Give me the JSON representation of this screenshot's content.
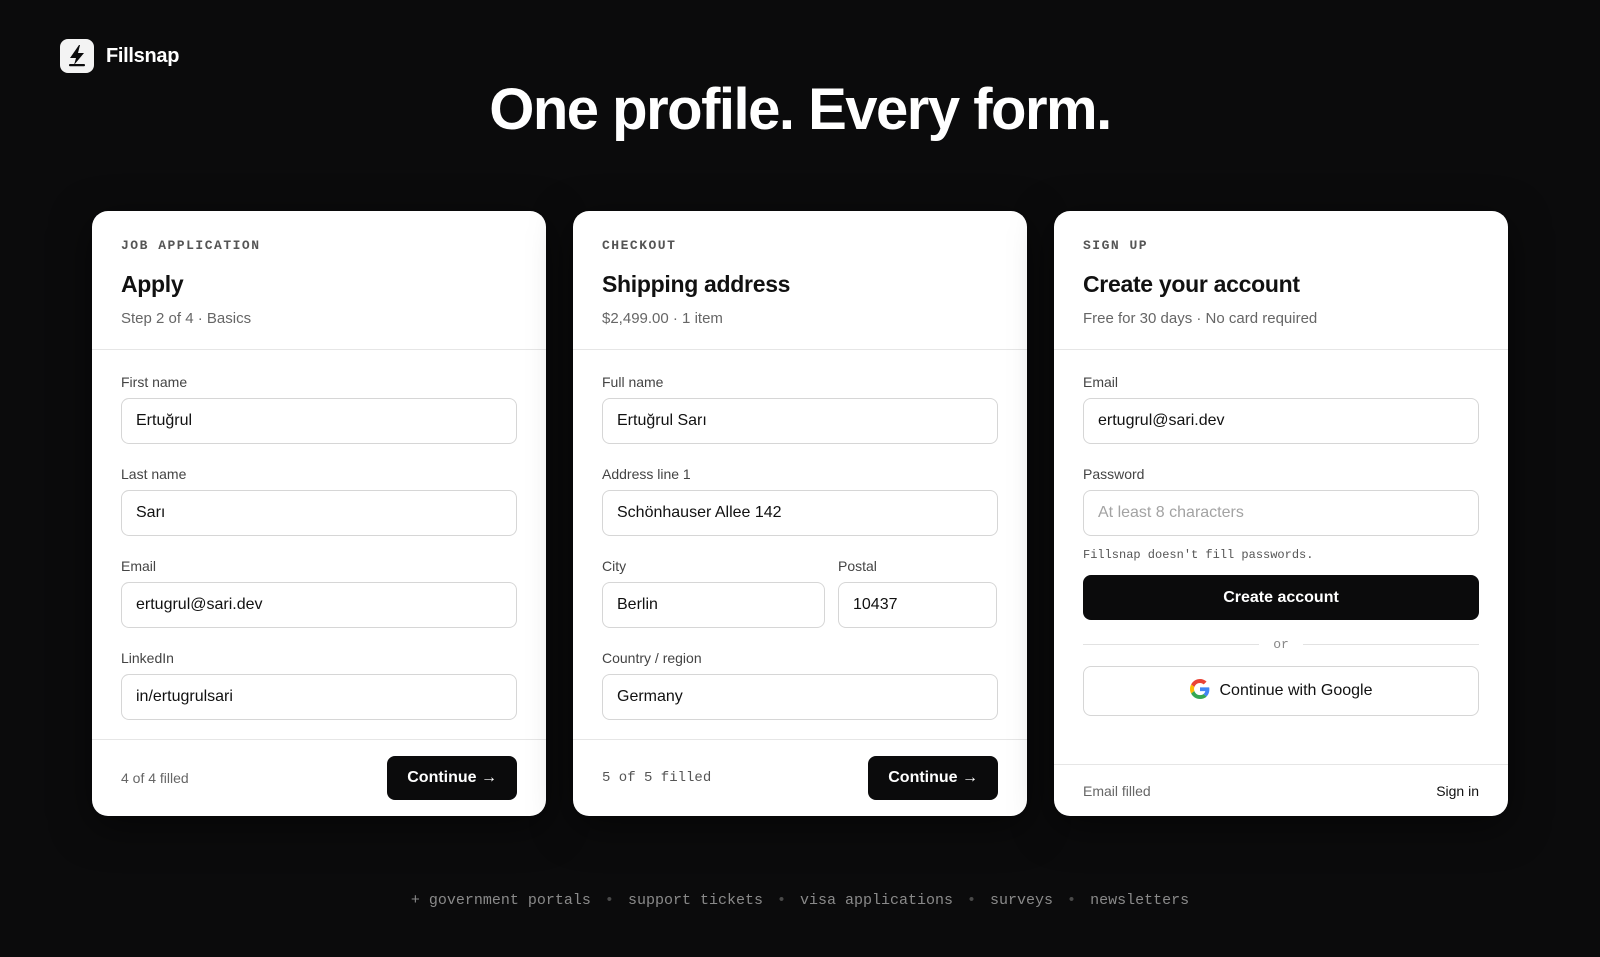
{
  "brand": {
    "name": "Fillsnap",
    "icon": "lightning-bolt-icon"
  },
  "headline": "One profile. Every form.",
  "cards": {
    "job": {
      "eyebrow": "JOB APPLICATION",
      "title": "Apply",
      "subtitle": "Step 2 of 4 · Basics",
      "fields": {
        "first_name": {
          "label": "First name",
          "value": "Ertuğrul"
        },
        "last_name": {
          "label": "Last name",
          "value": "Sarı"
        },
        "email": {
          "label": "Email",
          "value": "ertugrul@sari.dev"
        },
        "linkedin": {
          "label": "LinkedIn",
          "value": "in/ertugrulsari"
        }
      },
      "footer_status": "4 of 4 filled",
      "continue_label": "Continue →"
    },
    "checkout": {
      "eyebrow": "CHECKOUT",
      "title": "Shipping address",
      "subtitle": "$2,499.00 · 1 item",
      "fields": {
        "full_name": {
          "label": "Full name",
          "value": "Ertuğrul Sarı"
        },
        "address1": {
          "label": "Address line 1",
          "value": "Schönhauser Allee 142"
        },
        "city": {
          "label": "City",
          "value": "Berlin"
        },
        "postal": {
          "label": "Postal",
          "value": "10437"
        },
        "country": {
          "label": "Country / region",
          "value": "Germany"
        }
      },
      "footer_status": "5 of 5 filled",
      "continue_label": "Continue →"
    },
    "signup": {
      "eyebrow": "SIGN UP",
      "title": "Create your account",
      "subtitle": "Free for 30 days · No card required",
      "fields": {
        "email": {
          "label": "Email",
          "value": "ertugrul@sari.dev"
        },
        "password": {
          "label": "Password",
          "placeholder": "At least 8 characters"
        }
      },
      "password_hint": "Fillsnap doesn't fill passwords.",
      "create_label": "Create account",
      "divider_text": "or",
      "google_label": "Continue with Google",
      "footer_status": "Email filled",
      "signin_label": "Sign in"
    }
  },
  "tagline": {
    "items": [
      "+ government portals",
      "support tickets",
      "visa applications",
      "surveys",
      "newsletters"
    ],
    "separator": "•"
  },
  "colors": {
    "background": "#0b0b0c",
    "card": "#ffffff",
    "button": "#0b0b0c"
  }
}
